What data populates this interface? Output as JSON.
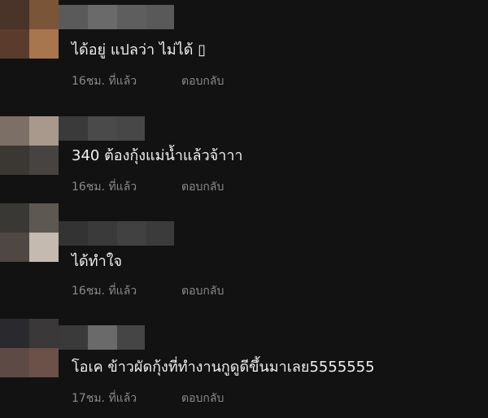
{
  "comments": [
    {
      "text": "ได้อยู่ แปลว่า ไม่ได้ ▯",
      "time": "16ชม. ที่แล้ว",
      "reply": "ตอบกลับ",
      "avatar_colors": [
        "#4a3328",
        "#7a5538",
        "#5b3c2c",
        "#a8764e"
      ],
      "name_blur_colors": [
        "#5a5a5a",
        "#6a6a6a",
        "#5e5e5e",
        "#595959"
      ]
    },
    {
      "text": "340 ต้องกุ้งแม่น้ำแล้วจ้าาา",
      "time": "16ชม. ที่แล้ว",
      "reply": "ตอบกลับ",
      "avatar_colors": [
        "#7b6f66",
        "#a9998c",
        "#3b3834",
        "#464340"
      ],
      "name_blur_colors": [
        "#3a3a3a",
        "#4a4a4a",
        "#474747"
      ]
    },
    {
      "text": "ได้ทำใจ",
      "time": "16ชม. ที่แล้ว",
      "reply": "ตอบกลับ",
      "avatar_colors": [
        "#3a3835",
        "#5e5853",
        "#4e4743",
        "#c4bab0"
      ],
      "name_blur_colors": [
        "#333333",
        "#3a3a3a",
        "#414141",
        "#3b3b3b"
      ]
    },
    {
      "text": "โอเค ข้าวผัดกุ้งที่ทำงานกูดูดีขึ้นมาเลย5555555",
      "time": "17ชม. ที่แล้ว",
      "reply": "ตอบกลับ",
      "avatar_colors": [
        "#2a2a2e",
        "#3a3838",
        "#5e4a44",
        "#6b5147"
      ],
      "name_blur_colors": [
        "#3a3a3a",
        "#6a6a6a",
        "#454545"
      ]
    }
  ]
}
